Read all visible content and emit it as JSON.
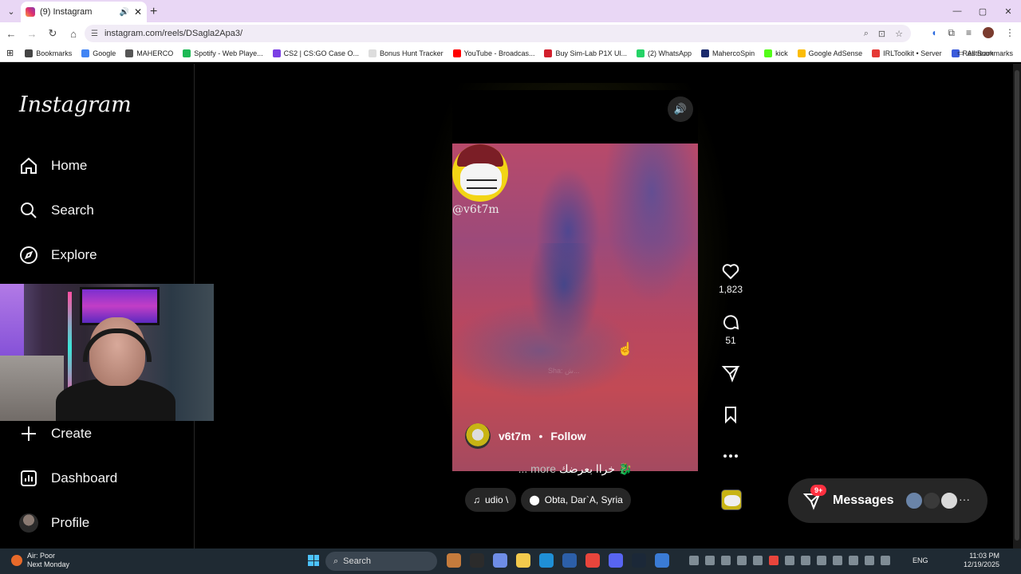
{
  "browser": {
    "tab_title": "(9) Instagram",
    "url": "instagram.com/reels/DSagla2Apa3/",
    "new_tab": "+",
    "window_controls": [
      "—",
      "▢",
      "✕"
    ]
  },
  "bookmarks": {
    "items": [
      {
        "label": "Bookmarks",
        "color": "#444444"
      },
      {
        "label": "Google",
        "color": "#4285f4"
      },
      {
        "label": "MAHERCO",
        "color": "#555555"
      },
      {
        "label": "Spotify - Web Playe...",
        "color": "#1db954"
      },
      {
        "label": "CS2 | CS:GO Case O...",
        "color": "#7b3fe4"
      },
      {
        "label": "Bonus Hunt Tracker",
        "color": "#dddddd"
      },
      {
        "label": "YouTube - Broadcas...",
        "color": "#ff0000"
      },
      {
        "label": "Buy Sim-Lab P1X Ul...",
        "color": "#d21f2c"
      },
      {
        "label": "(2) WhatsApp",
        "color": "#25d366"
      },
      {
        "label": "MahercoSpin",
        "color": "#1a2a6c"
      },
      {
        "label": "kick",
        "color": "#53fc18"
      },
      {
        "label": "Google AdSense",
        "color": "#fbbc05"
      },
      {
        "label": "IRLToolkit • Server",
        "color": "#e53935"
      },
      {
        "label": "Restream",
        "color": "#3b5bdb"
      }
    ],
    "all_bookmarks": "All Bookmarks"
  },
  "sidebar": {
    "logo": "Instagram",
    "nav": {
      "home": "Home",
      "search": "Search",
      "explore": "Explore",
      "create": "Create",
      "dashboard": "Dashboard",
      "profile": "Profile"
    }
  },
  "reel": {
    "overlay_handle": "@v6t7m",
    "author": "v6t7m",
    "separator": "•",
    "follow": "Follow",
    "caption": "خراا بعرضك 🐉",
    "caption_more": "... more",
    "audio_label": "udio \\",
    "location": "Obta, Dar`A, Syria",
    "watermark": "Sha: ش..."
  },
  "actions": {
    "likes": "1,823",
    "comments": "51"
  },
  "messages": {
    "label": "Messages",
    "badge": "9+",
    "more": "···"
  },
  "taskbar": {
    "weather_title": "Air: Poor",
    "weather_sub": "Next Monday",
    "search": "Search",
    "lang": "ENG",
    "time": "11:03 PM",
    "date": "12/19/2025"
  },
  "colors": {
    "accent_story": "#c8b414",
    "badge_red": "#ff3040",
    "page_bg": "#000000"
  }
}
